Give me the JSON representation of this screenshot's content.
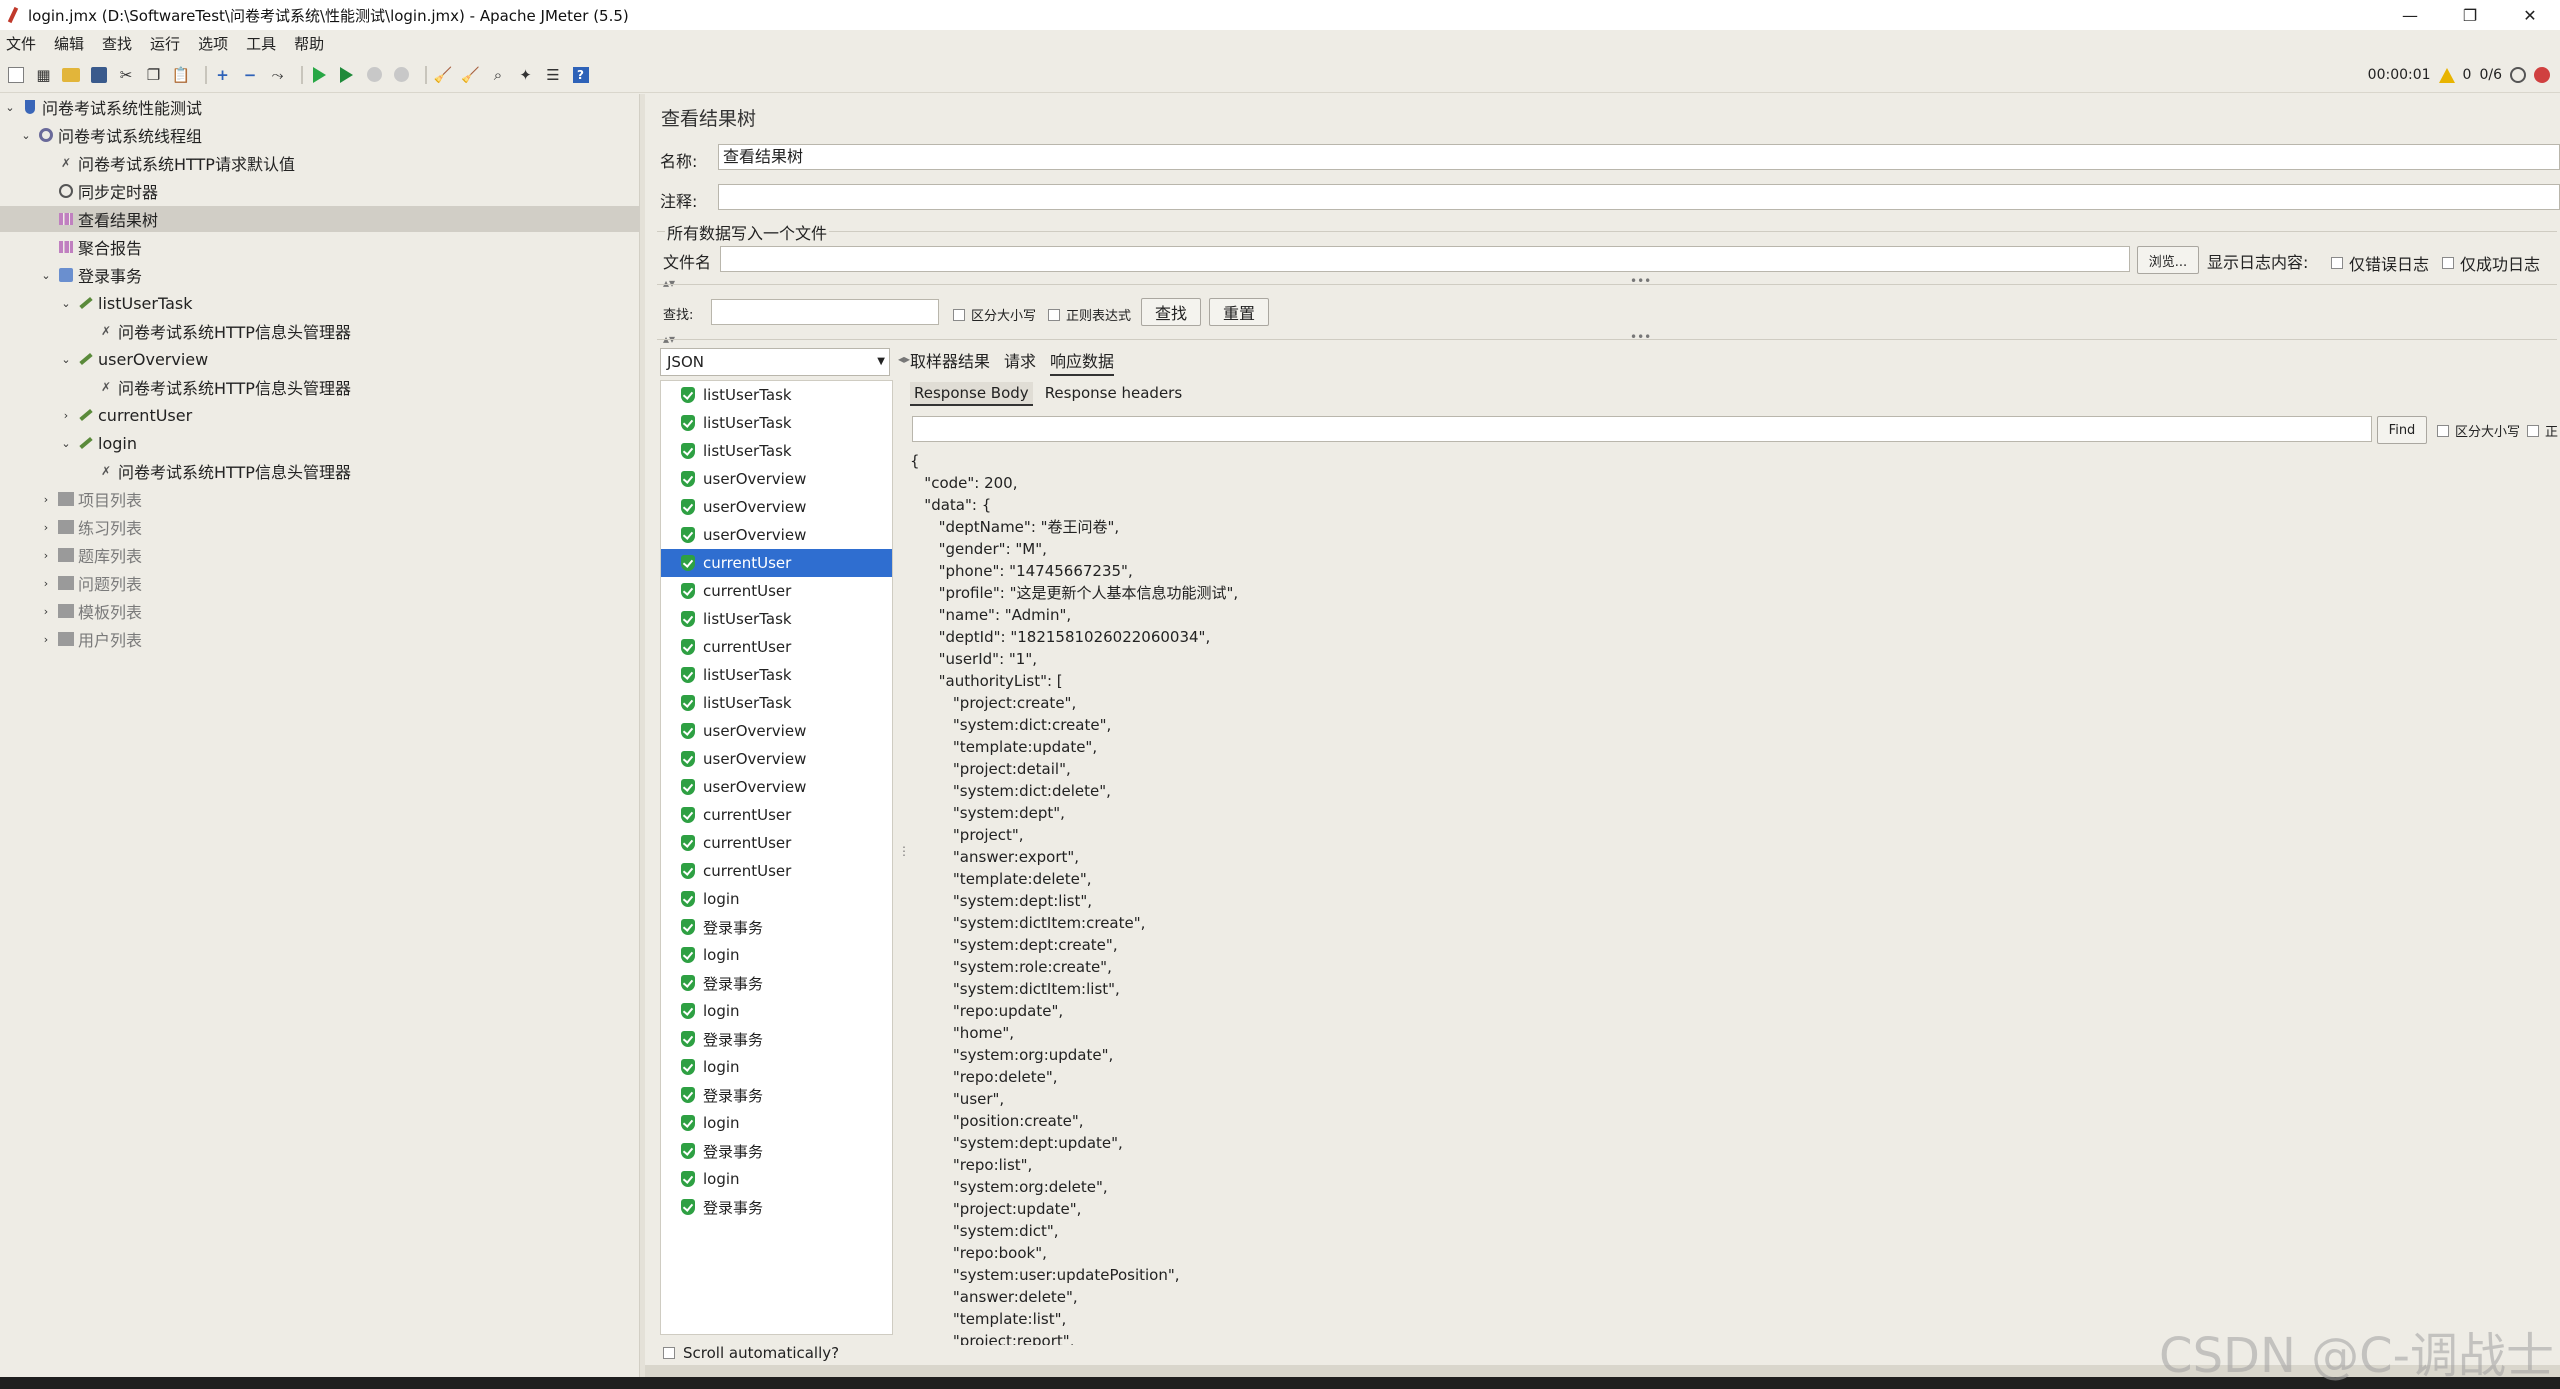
{
  "window": {
    "title": "login.jmx (D:\\SoftwareTest\\问卷考试系统\\性能测试\\login.jmx) - Apache JMeter (5.5)",
    "controls": [
      "—",
      "❐",
      "✕"
    ]
  },
  "menu": [
    "文件",
    "编辑",
    "查找",
    "运行",
    "选项",
    "工具",
    "帮助"
  ],
  "toolbar": {
    "timer": "00:00:01",
    "warnings": "0",
    "threads": "0/6"
  },
  "tree": [
    {
      "label": "问卷考试系统性能测试",
      "icon": "flask-icon",
      "arrow": "⌄"
    },
    {
      "label": "问卷考试系统线程组",
      "icon": "gear-icon",
      "arrow": "⌄"
    },
    {
      "label": "问卷考试系统HTTP请求默认值",
      "icon": "wrench-icon",
      "arrow": ""
    },
    {
      "label": "同步定时器",
      "icon": "clock-icon",
      "arrow": ""
    },
    {
      "label": "查看结果树",
      "icon": "chart-icon",
      "arrow": ""
    },
    {
      "label": "聚合报告",
      "icon": "chart-icon",
      "arrow": ""
    },
    {
      "label": "登录事务",
      "icon": "transaction-icon",
      "arrow": "⌄"
    },
    {
      "label": "listUserTask",
      "icon": "pen-icon",
      "arrow": "⌄"
    },
    {
      "label": "问卷考试系统HTTP信息头管理器",
      "icon": "wrench-icon",
      "arrow": ""
    },
    {
      "label": "userOverview",
      "icon": "pen-icon",
      "arrow": "⌄"
    },
    {
      "label": "问卷考试系统HTTP信息头管理器",
      "icon": "wrench-icon",
      "arrow": ""
    },
    {
      "label": "currentUser",
      "icon": "pen-icon",
      "arrow": "›"
    },
    {
      "label": "login",
      "icon": "pen-icon",
      "arrow": "⌄"
    },
    {
      "label": "问卷考试系统HTTP信息头管理器",
      "icon": "wrench-icon",
      "arrow": ""
    },
    {
      "label": "项目列表",
      "icon": "box-icon",
      "arrow": "›"
    },
    {
      "label": "练习列表",
      "icon": "box-icon",
      "arrow": "›"
    },
    {
      "label": "题库列表",
      "icon": "box-icon",
      "arrow": "›"
    },
    {
      "label": "问题列表",
      "icon": "box-icon",
      "arrow": "›"
    },
    {
      "label": "模板列表",
      "icon": "box-icon",
      "arrow": "›"
    },
    {
      "label": "用户列表",
      "icon": "box-icon",
      "arrow": "›"
    }
  ],
  "panel": {
    "title": "查看结果树",
    "name_label": "名称:",
    "name_value": "查看结果树",
    "comment_label": "注释:",
    "comment_value": "",
    "file_group": "所有数据写入一个文件",
    "file_label": "文件名",
    "file_value": "",
    "browse": "浏览...",
    "log_content": "显示日志内容:",
    "errors_only": "仅错误日志",
    "success_only": "仅成功日志",
    "search_label": "查找:",
    "search_value": "",
    "case_sensitive": "区分大小写",
    "regex": "正则表达式",
    "find_btn": "查找",
    "reset_btn": "重置"
  },
  "results": {
    "renderer": "JSON",
    "scroll_auto": "Scroll automatically?",
    "items": [
      "listUserTask",
      "listUserTask",
      "listUserTask",
      "userOverview",
      "userOverview",
      "userOverview",
      "currentUser",
      "currentUser",
      "listUserTask",
      "currentUser",
      "listUserTask",
      "listUserTask",
      "userOverview",
      "userOverview",
      "userOverview",
      "currentUser",
      "currentUser",
      "currentUser",
      "login",
      "登录事务",
      "login",
      "登录事务",
      "login",
      "登录事务",
      "login",
      "登录事务",
      "login",
      "登录事务",
      "login",
      "登录事务"
    ]
  },
  "tabs": [
    "取样器结果",
    "请求",
    "响应数据"
  ],
  "subtabs": [
    "Response Body",
    "Response headers"
  ],
  "response": {
    "find_btn": "Find",
    "case_label": "区分大小写",
    "regex_label": "正",
    "body": "{\n   \"code\": 200,\n   \"data\": {\n      \"deptName\": \"卷王问卷\",\n      \"gender\": \"M\",\n      \"phone\": \"14745667235\",\n      \"profile\": \"这是更新个人基本信息功能测试\",\n      \"name\": \"Admin\",\n      \"deptId\": \"1821581026022060034\",\n      \"userId\": \"1\",\n      \"authorityList\": [\n         \"project:create\",\n         \"system:dict:create\",\n         \"template:update\",\n         \"project:detail\",\n         \"system:dict:delete\",\n         \"system:dept\",\n         \"project\",\n         \"answer:export\",\n         \"template:delete\",\n         \"system:dept:list\",\n         \"system:dictItem:create\",\n         \"system:dept:create\",\n         \"system:role:create\",\n         \"system:dictItem:list\",\n         \"repo:update\",\n         \"home\",\n         \"system:org:update\",\n         \"repo:delete\",\n         \"user\",\n         \"position:create\",\n         \"system:dept:update\",\n         \"repo:list\",\n         \"system:org:delete\",\n         \"project:update\",\n         \"system:dict\",\n         \"repo:book\",\n         \"system:user:updatePosition\",\n         \"answer:delete\",\n         \"template:list\",\n         \"project:report\","
  },
  "watermark": "CSDN @C-调战士"
}
